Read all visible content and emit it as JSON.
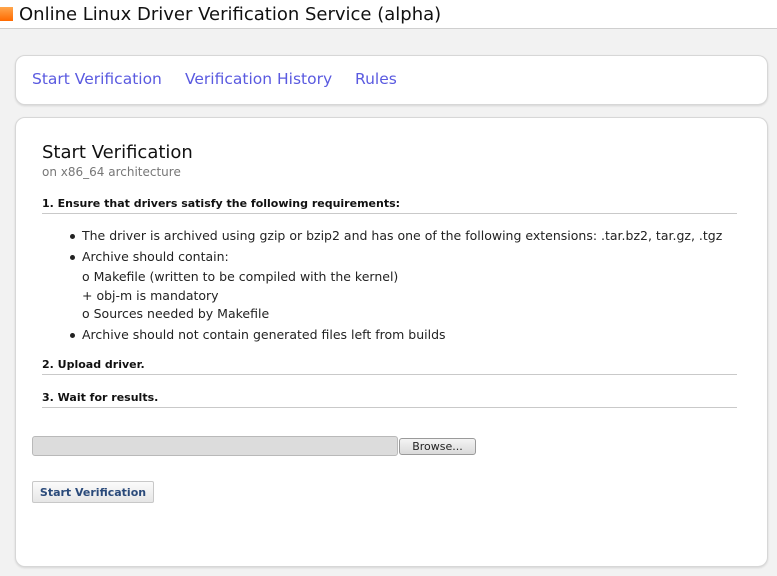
{
  "header": {
    "title": "Online Linux Driver Verification Service (alpha)",
    "icon": "orange-square-icon",
    "accent_color": "#ff8a2a"
  },
  "nav": {
    "start_verification": "Start Verification",
    "verification_history": "Verification History",
    "rules": "Rules",
    "link_color": "#5a5ae0"
  },
  "main": {
    "title": "Start Verification",
    "subtitle": "on x86_64 architecture",
    "steps": [
      "1. Ensure that drivers satisfy the following requirements:",
      "2. Upload driver.",
      "3. Wait for results."
    ],
    "requirements": {
      "archive_format": "The driver is archived using gzip or bzip2 and has one of the following extensions: .tar.bz2, tar.gz, .tgz",
      "archive_contain": "Archive should contain:",
      "makefile": "o Makefile (written to be compiled with the kernel)",
      "objm": "+ obj-m is mandatory",
      "sources": "o Sources needed by Makefile",
      "no_generated": "Archive should not contain generated files left from builds"
    },
    "upload": {
      "file_value": "",
      "browse_label": "Browse..."
    },
    "submit_label": "Start Verification"
  }
}
